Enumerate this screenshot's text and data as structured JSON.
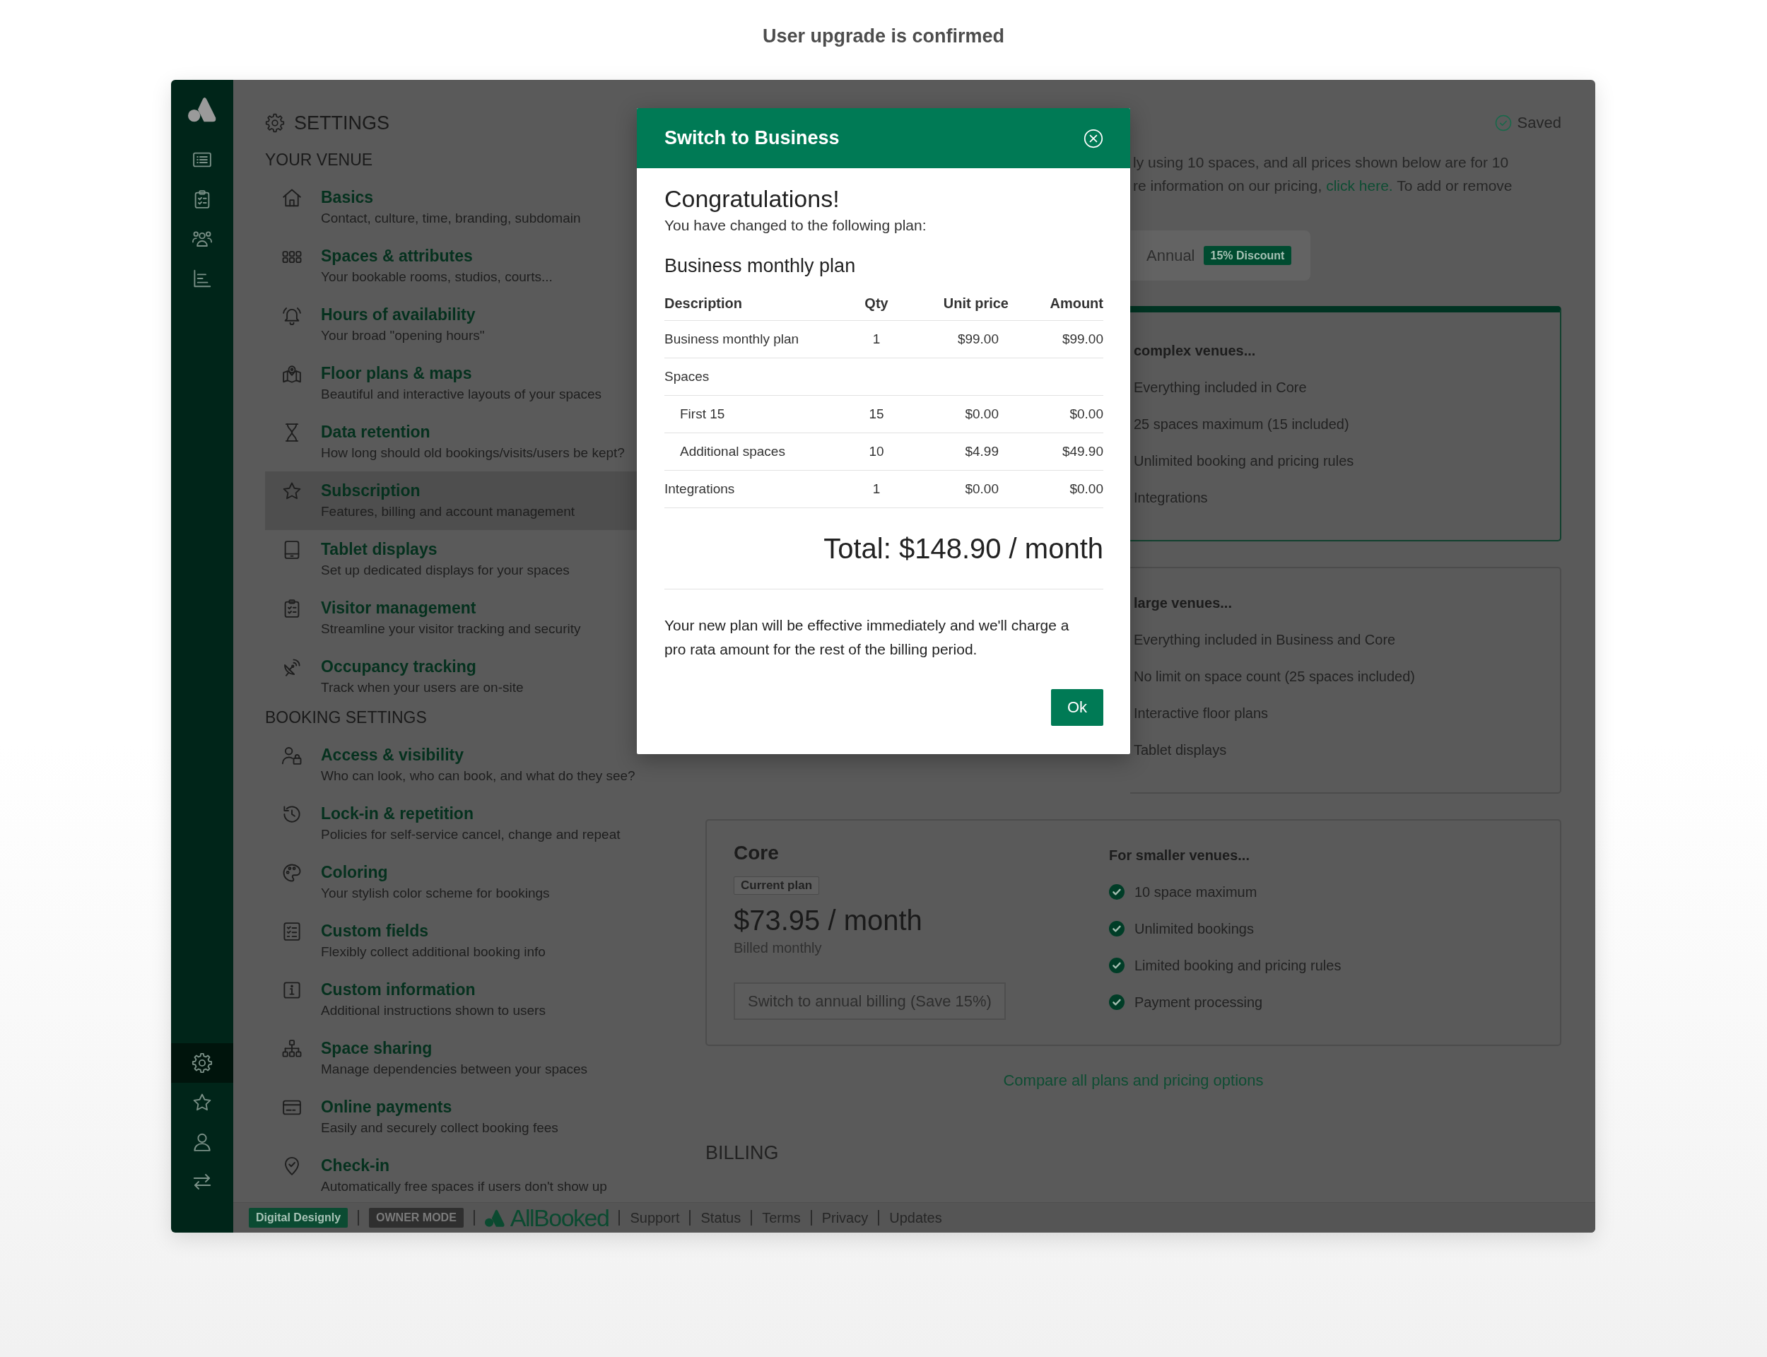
{
  "page_title": "User upgrade is confirmed",
  "sidebar": {
    "top_items": [
      {
        "selected": false
      },
      {
        "selected": false
      },
      {
        "selected": false
      },
      {
        "selected": false
      }
    ],
    "bottom_items": [
      {
        "selected": true
      },
      {
        "selected": false
      },
      {
        "selected": false
      },
      {
        "selected": false
      }
    ]
  },
  "settings": {
    "title": "SETTINGS",
    "sections": [
      {
        "heading": "YOUR VENUE",
        "items": [
          {
            "title": "Basics",
            "description": "Contact, culture, time, branding, subdomain",
            "selected": false
          },
          {
            "title": "Spaces & attributes",
            "description": "Your bookable rooms, studios, courts...",
            "selected": false
          },
          {
            "title": "Hours of availability",
            "description": "Your broad \"opening hours\"",
            "selected": false
          },
          {
            "title": "Floor plans & maps",
            "description": "Beautiful and interactive layouts of your spaces",
            "selected": false
          },
          {
            "title": "Data retention",
            "description": "How long should old bookings/visits/users be kept?",
            "selected": false
          },
          {
            "title": "Subscription",
            "description": "Features, billing and account management",
            "selected": true
          },
          {
            "title": "Tablet displays",
            "description": "Set up dedicated displays for your spaces",
            "selected": false
          },
          {
            "title": "Visitor management",
            "description": "Streamline your visitor tracking and security",
            "selected": false
          },
          {
            "title": "Occupancy tracking",
            "description": "Track when your users are on-site",
            "selected": false
          }
        ]
      },
      {
        "heading": "BOOKING SETTINGS",
        "items": [
          {
            "title": "Access & visibility",
            "description": "Who can look, who can book, and what do they see?",
            "selected": false
          },
          {
            "title": "Lock-in & repetition",
            "description": "Policies for self-service cancel, change and repeat",
            "selected": false
          },
          {
            "title": "Coloring",
            "description": "Your stylish color scheme for bookings",
            "selected": false
          },
          {
            "title": "Custom fields",
            "description": "Flexibly collect additional booking info",
            "selected": false
          },
          {
            "title": "Custom information",
            "description": "Additional instructions shown to users",
            "selected": false
          },
          {
            "title": "Space sharing",
            "description": "Manage dependencies between your spaces",
            "selected": false
          },
          {
            "title": "Online payments",
            "description": "Easily and securely collect booking fees",
            "selected": false
          },
          {
            "title": "Check-in",
            "description": "Automatically free spaces if users don't show up",
            "selected": false
          }
        ]
      }
    ]
  },
  "main": {
    "saved_label": "Saved",
    "intro_lines": [
      {
        "text": "ly using 10 spaces, and all prices shown below are for 10"
      },
      {
        "text": "re information on our pricing, ",
        "link": "click here.",
        "after": " To add or remove"
      }
    ],
    "billing_toggle": {
      "options": [
        {
          "label": "Annual",
          "badge": "15% Discount",
          "selected": false
        }
      ]
    },
    "plans": [
      {
        "tagline": "complex venues...",
        "features": [
          "Everything included in Core",
          "25 spaces maximum (15 included)",
          "Unlimited booking and pricing rules",
          "Integrations"
        ],
        "selected": true
      },
      {
        "tagline": "large venues...",
        "features": [
          "Everything included in Business and Core",
          "No limit on space count (25 spaces included)",
          "Interactive floor plans",
          "Tablet displays"
        ],
        "selected": false
      },
      {
        "name": "Core",
        "badge": "Current plan",
        "price": "$73.95 / month",
        "billing": "Billed monthly",
        "button": "Switch to annual billing (Save 15%)",
        "tagline": "For smaller venues...",
        "features": [
          "10 space maximum",
          "Unlimited bookings",
          "Limited booking and pricing rules",
          "Payment processing"
        ],
        "selected": false
      }
    ],
    "compare_link": "Compare all plans and pricing options",
    "billing_heading": "BILLING"
  },
  "modal": {
    "title": "Switch to Business",
    "heading": "Congratulations!",
    "subtitle": "You have changed to the following plan:",
    "plan_name": "Business monthly plan",
    "table": {
      "columns": [
        "Description",
        "Qty",
        "Unit price",
        "Amount"
      ],
      "rows": [
        {
          "cells": [
            "Business monthly plan",
            "1",
            "$99.00",
            "$99.00"
          ]
        },
        {
          "cells": [
            "Spaces"
          ],
          "children": [
            {
              "cells": [
                "First 15",
                "15",
                "$0.00",
                "$0.00"
              ]
            },
            {
              "cells": [
                "Additional spaces",
                "10",
                "$4.99",
                "$49.90"
              ]
            }
          ]
        },
        {
          "cells": [
            "Integrations",
            "1",
            "$0.00",
            "$0.00"
          ]
        }
      ]
    },
    "total": "Total: $148.90 / month",
    "note": "Your new plan will be effective immediately and we'll charge a pro rata amount for the rest of the billing period.",
    "ok_button": "Ok"
  },
  "footer": {
    "workspace_badge": "Digital Designly",
    "mode_badge": "OWNER MODE",
    "brand": "AllBooked",
    "links": [
      "Support",
      "Status",
      "Terms",
      "Privacy",
      "Updates"
    ]
  }
}
